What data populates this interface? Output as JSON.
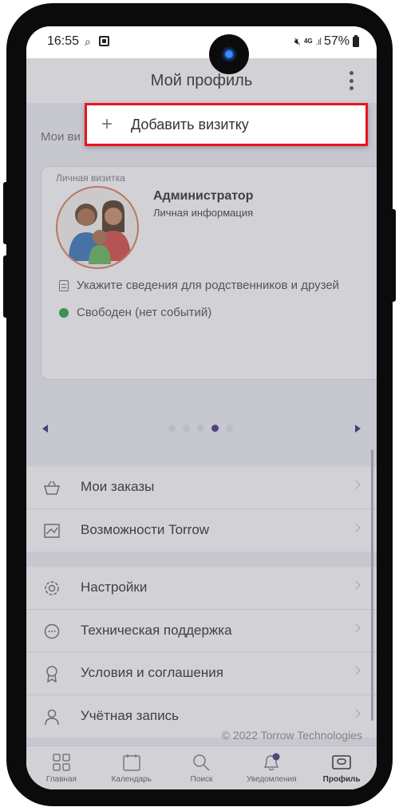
{
  "status_bar": {
    "time": "16:55",
    "network": "4G",
    "battery": "57%"
  },
  "header": {
    "title": "Мой профиль"
  },
  "section_label": "Мои ви",
  "card": {
    "tag": "Личная визитка",
    "name": "Администратор",
    "subtitle": "Личная информация",
    "info_text": "Укажите сведения для родственников и друзей",
    "status_text": "Свободен (нет событий)"
  },
  "pager": {
    "pages": 5,
    "active_index": 3
  },
  "menu_group_1": [
    {
      "label": "Мои заказы",
      "icon": "basket-icon"
    },
    {
      "label": "Возможности Torrow",
      "icon": "features-icon"
    }
  ],
  "menu_group_2": [
    {
      "label": "Настройки",
      "icon": "gear-icon"
    },
    {
      "label": "Техническая поддержка",
      "icon": "chat-icon"
    },
    {
      "label": "Условия и соглашения",
      "icon": "award-icon"
    },
    {
      "label": "Учётная запись",
      "icon": "user-icon"
    }
  ],
  "copyright": "© 2022 Torrow Technologies",
  "tabs": [
    {
      "label": "Главная",
      "icon": "grid-icon"
    },
    {
      "label": "Календарь",
      "icon": "calendar-icon"
    },
    {
      "label": "Поиск",
      "icon": "search-icon"
    },
    {
      "label": "Уведомления",
      "icon": "bell-icon",
      "badge": "1"
    },
    {
      "label": "Профиль",
      "icon": "profile-card-icon",
      "active": true
    }
  ],
  "popup_menu": {
    "add_card_label": "Добавить визитку"
  },
  "colors": {
    "highlight_border": "#e8141d",
    "status_green": "#1f9d3a",
    "pager_active": "#3b2c7a"
  }
}
